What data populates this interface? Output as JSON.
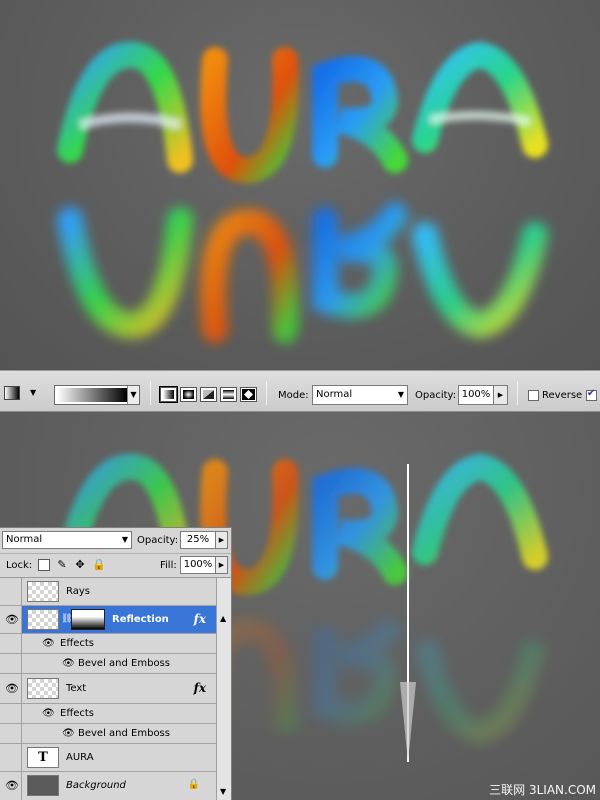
{
  "artwork": {
    "title_text": "AURA",
    "letter_colors": [
      "#2d8de0",
      "#e06a10",
      "#1a6ed8",
      "#20b090"
    ],
    "accent_colors": [
      "#3fd23a",
      "#f0c020",
      "#1660e0",
      "#30d0ff"
    ]
  },
  "toolbar": {
    "mode_label": "Mode:",
    "mode_value": "Normal",
    "opacity_label": "Opacity:",
    "opacity_value": "100%",
    "reverse_label": "Reverse",
    "reverse_checked": false,
    "dither_checked": true,
    "gradient_types": [
      "linear",
      "radial",
      "angle",
      "reflected",
      "diamond"
    ],
    "active_gradient_type": "linear"
  },
  "layers_panel": {
    "blend_mode": "Normal",
    "opacity_label": "Opacity:",
    "opacity_value": "25%",
    "lock_label": "Lock:",
    "fill_label": "Fill:",
    "fill_value": "100%",
    "layers": [
      {
        "name": "Rays",
        "visible": false,
        "thumbnail": "transparent"
      },
      {
        "name": "Reflection",
        "visible": true,
        "selected": true,
        "has_mask": true,
        "has_fx": true
      },
      {
        "effects_label": "Effects",
        "effect": "Bevel and Emboss"
      },
      {
        "name": "Text",
        "visible": true,
        "has_fx": true
      },
      {
        "effects_label": "Effects",
        "effect": "Bevel and Emboss"
      },
      {
        "name": "AURA",
        "visible": false,
        "thumbnail": "type"
      },
      {
        "name": "Background",
        "visible": true,
        "locked": true
      }
    ]
  },
  "watermark": "三联网 3LIAN.COM"
}
